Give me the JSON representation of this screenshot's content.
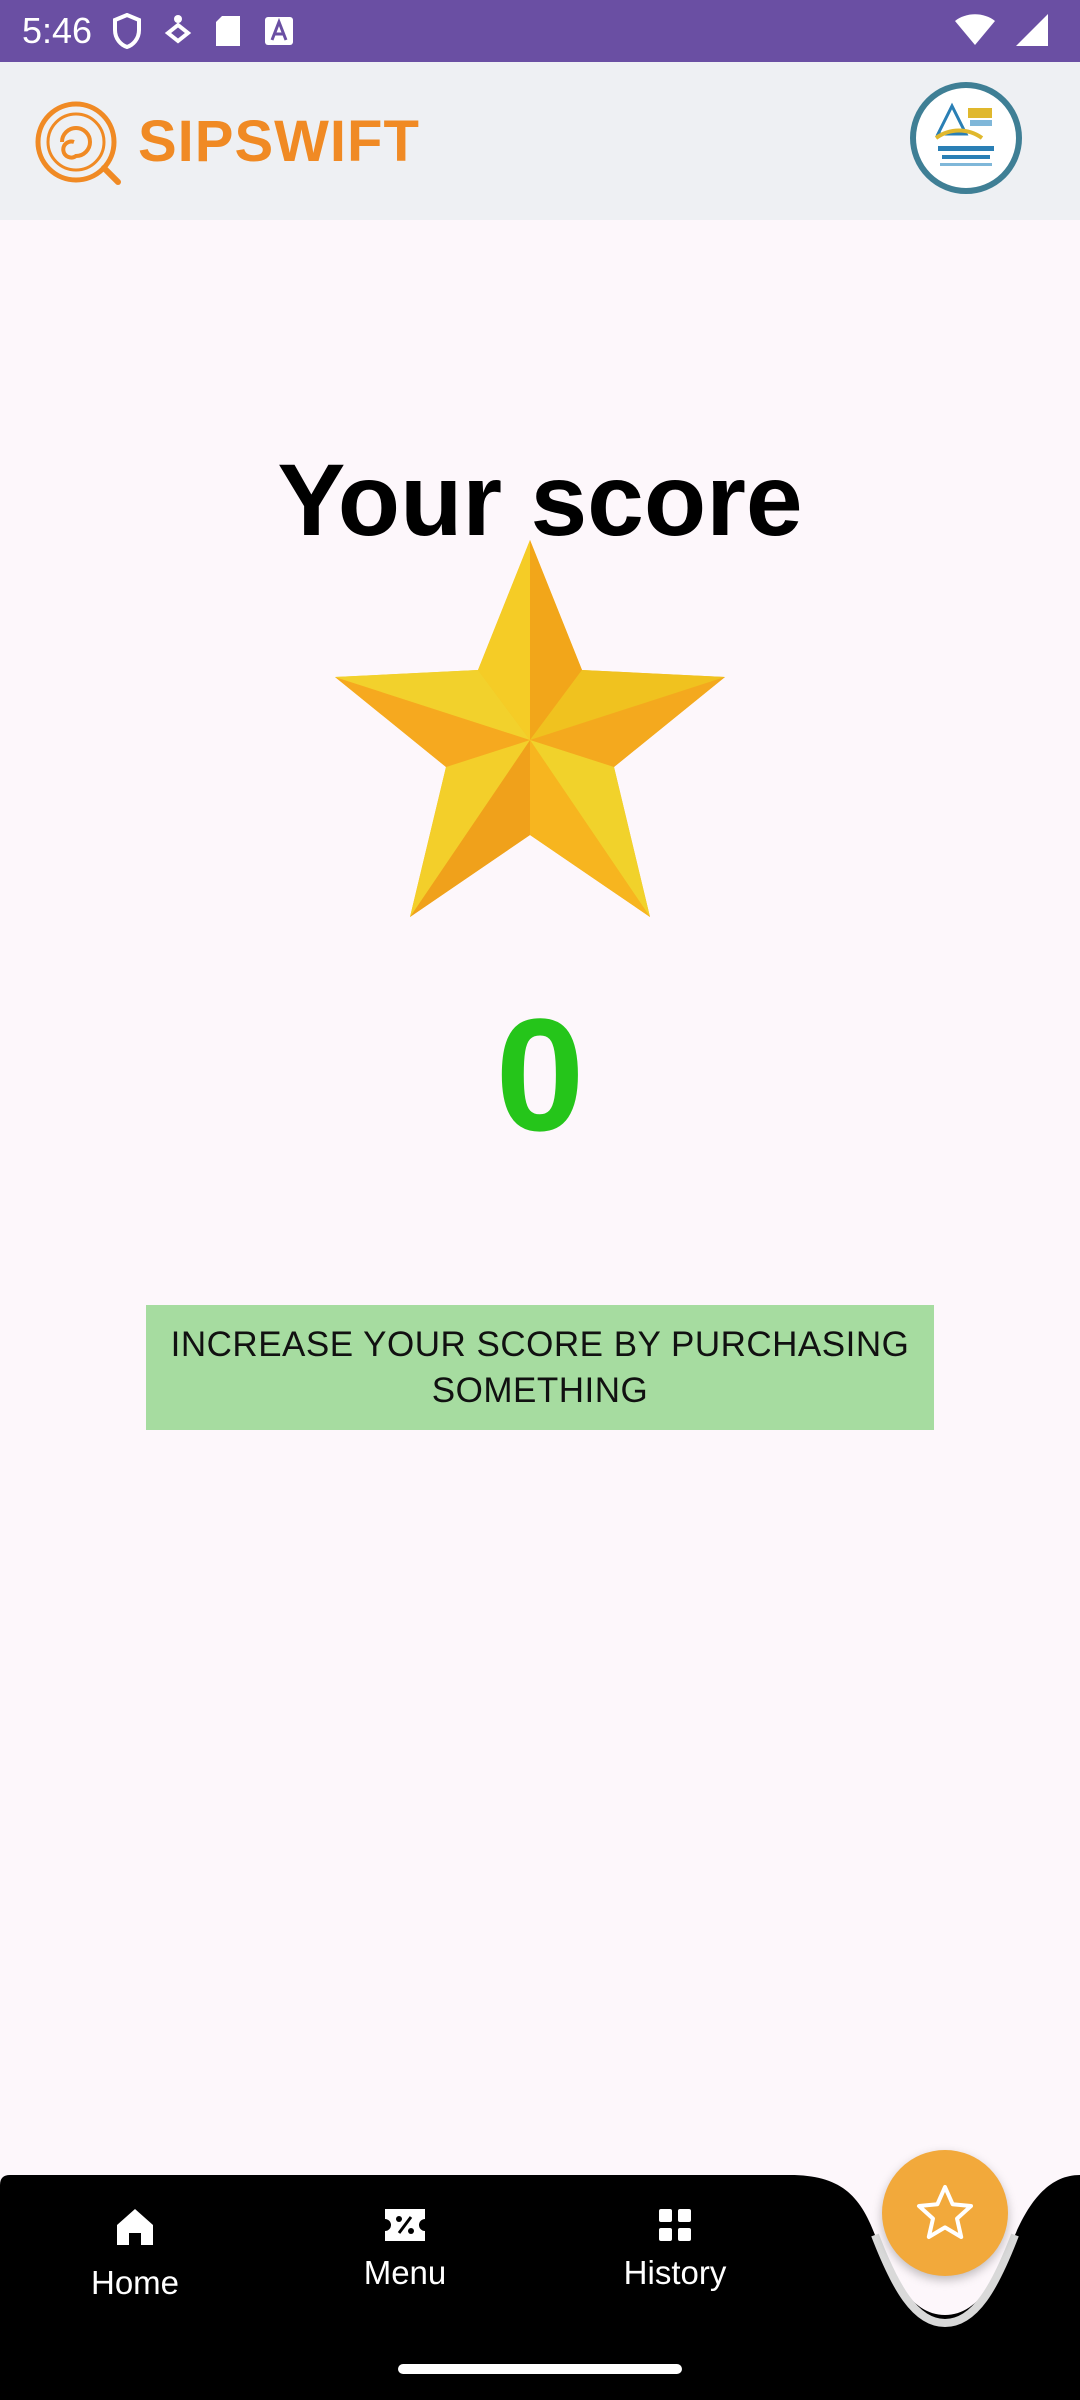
{
  "status": {
    "time": "5:46"
  },
  "header": {
    "logo_text": "SIPSWIFT"
  },
  "score": {
    "title": "Your score",
    "value": "0",
    "cta": "INCREASE YOUR SCORE BY PURCHASING SOMETHING"
  },
  "nav": {
    "items": [
      {
        "label": "Home",
        "icon": "home-icon"
      },
      {
        "label": "Menu",
        "icon": "ticket-icon"
      },
      {
        "label": "History",
        "icon": "grid-icon"
      }
    ],
    "fab_icon": "star-icon"
  },
  "colors": {
    "status_bar": "#6a4fa3",
    "brand_orange": "#f08a24",
    "score_green": "#25c51a",
    "cta_bg": "#a6dca0",
    "nav_bg": "#000000",
    "fab": "#f2a93b"
  }
}
